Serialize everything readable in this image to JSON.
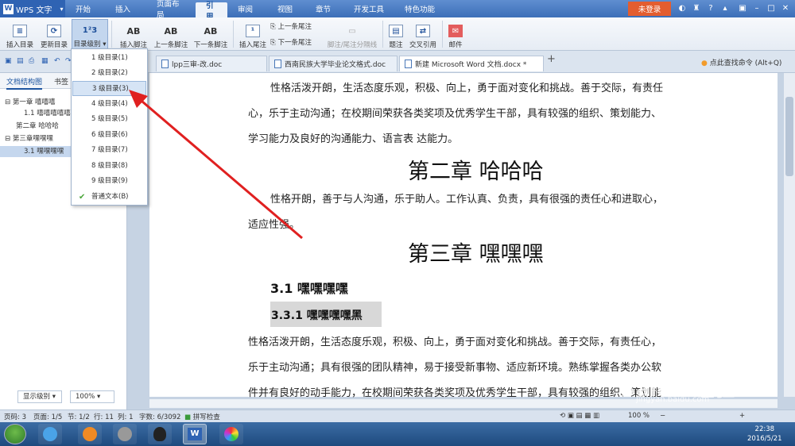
{
  "app": {
    "title": "WPS 文字",
    "login": "未登录"
  },
  "menu": [
    "开始",
    "插入",
    "页面布局",
    "引用",
    "审阅",
    "视图",
    "章节",
    "开发工具",
    "特色功能"
  ],
  "ribbon": {
    "insert_toc": "插入目录",
    "update_toc": "更新目录",
    "toc_level": "目录级别",
    "insert_footnote": "插入脚注",
    "prev_footnote": "上一条脚注",
    "next_footnote": "下一条脚注",
    "insert_endnote": "插入尾注",
    "prev_endnote": "上一条尾注",
    "next_endnote": "下一条尾注",
    "separator": "脚注/尾注分隔线",
    "caption": "题注",
    "crossref": "交叉引用",
    "mail": "邮件",
    "ab": "AB"
  },
  "tabs": [
    "lpp三审-改.doc",
    "西南民族大学毕业论文格式.doc",
    "新建 Microsoft Word 文档.docx *"
  ],
  "find_command": "点此查找命令 (Alt+Q)",
  "panel": {
    "tab_structure": "文档结构图",
    "tab_bookmark": "书签",
    "tree": [
      "第一章 嘻嘻嘻",
      "1.1 嘻嘻嘻嘻嘻",
      "第二章 哈哈哈",
      "第三章嘿嘿嘿",
      "3.1 嘿嘿嘿嘿"
    ],
    "show_level": "显示级别",
    "zoom": "100%"
  },
  "dropdown": [
    "1 级目录(1)",
    "2 级目录(2)",
    "3 级目录(3)",
    "4 级目录(4)",
    "5 级目录(5)",
    "6 级目录(6)",
    "7 级目录(7)",
    "8 级目录(8)",
    "9 级目录(9)",
    "普通文本(B)"
  ],
  "document": {
    "p1a": "性格活泼开朗，生活态度乐观，积极、向上，勇于面对变化和挑战。善于交际，有责任",
    "p1b": "心，乐于主动沟通；在校期间荣获各类奖项及优秀学生干部，具有较强的组织、策划能力、",
    "p1c": "学习能力及良好的沟通能力、语言表  达能力。",
    "ch2": "第二章  哈哈哈",
    "p2a": "性格开朗，善于与人沟通，乐于助人。工作认真、负责，具有很强的责任心和进取心，",
    "p2b": "适应性强。",
    "ch3": "第三章  嘿嘿嘿",
    "s31": "3.1  嘿嘿嘿嘿",
    "s331": "3.3.1  嘿嘿嘿嘿黑",
    "p3a": "性格活泼开朗，生活态度乐观，积极、向上，勇于面对变化和挑战。善于交际，有责任心，",
    "p3b": "乐于主动沟通；具有很强的团队精神，易于接受新事物、适应新环境。熟练掌握各类办公软",
    "p3c": "件并有良好的动手能力，在校期间荣获各类奖项及优秀学生干部，具有较强的组织、策划能"
  },
  "status": {
    "page": "页码: 3",
    "pages": "页面: 1/5",
    "section": "节: 1/2",
    "row": "行: 11",
    "col": "列: 1",
    "words": "字数: 6/3092",
    "spell": "拼写检查",
    "zoom": "100 %"
  },
  "clock": {
    "time": "22:38",
    "date": "2016/5/21"
  },
  "watermark": {
    "brand": "Baidu 经验",
    "url": "jingyan.baidu.com"
  }
}
